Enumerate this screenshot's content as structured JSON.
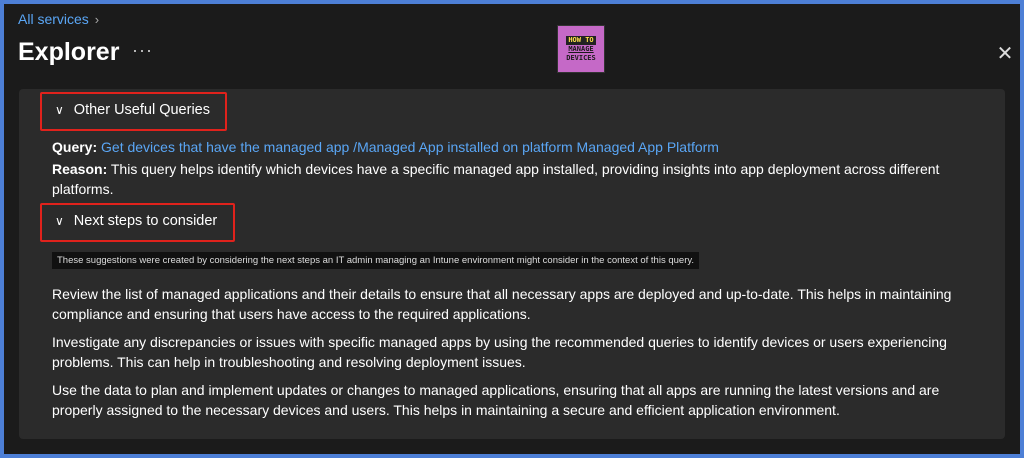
{
  "breadcrumb": {
    "label": "All services"
  },
  "header": {
    "title": "Explorer",
    "more": "···"
  },
  "logo": {
    "line1": "HOW TO",
    "line2": "MANAGE",
    "line3": "DEVICES"
  },
  "sections": {
    "other_queries": {
      "label": "Other Useful Queries"
    },
    "next_steps": {
      "label": "Next steps to consider"
    }
  },
  "query": {
    "label": "Query:",
    "link": "Get devices that have the managed app /Managed App installed on platform Managed App Platform"
  },
  "reason": {
    "label": "Reason:",
    "text": "This query helps identify which devices have a specific managed app installed, providing insights into app deployment across different platforms."
  },
  "disclaimer": "These suggestions were created by considering the next steps an IT admin managing an Intune environment might consider in the context of this query.",
  "steps": [
    "Review the list of managed applications and their details to ensure that all necessary apps are deployed and up-to-date. This helps in maintaining compliance and ensuring that users have access to the required applications.",
    "Investigate any discrepancies or issues with specific managed apps by using the recommended queries to identify devices or users experiencing problems. This can help in troubleshooting and resolving deployment issues.",
    "Use the data to plan and implement updates or changes to managed applications, ensuring that all apps are running the latest versions and are properly assigned to the necessary devices and users. This helps in maintaining a secure and efficient application environment."
  ],
  "colors": {
    "link": "#5aa6f5",
    "highlight": "#e0221c",
    "panel": "#2b2b2b",
    "background": "#1b1b1b"
  }
}
